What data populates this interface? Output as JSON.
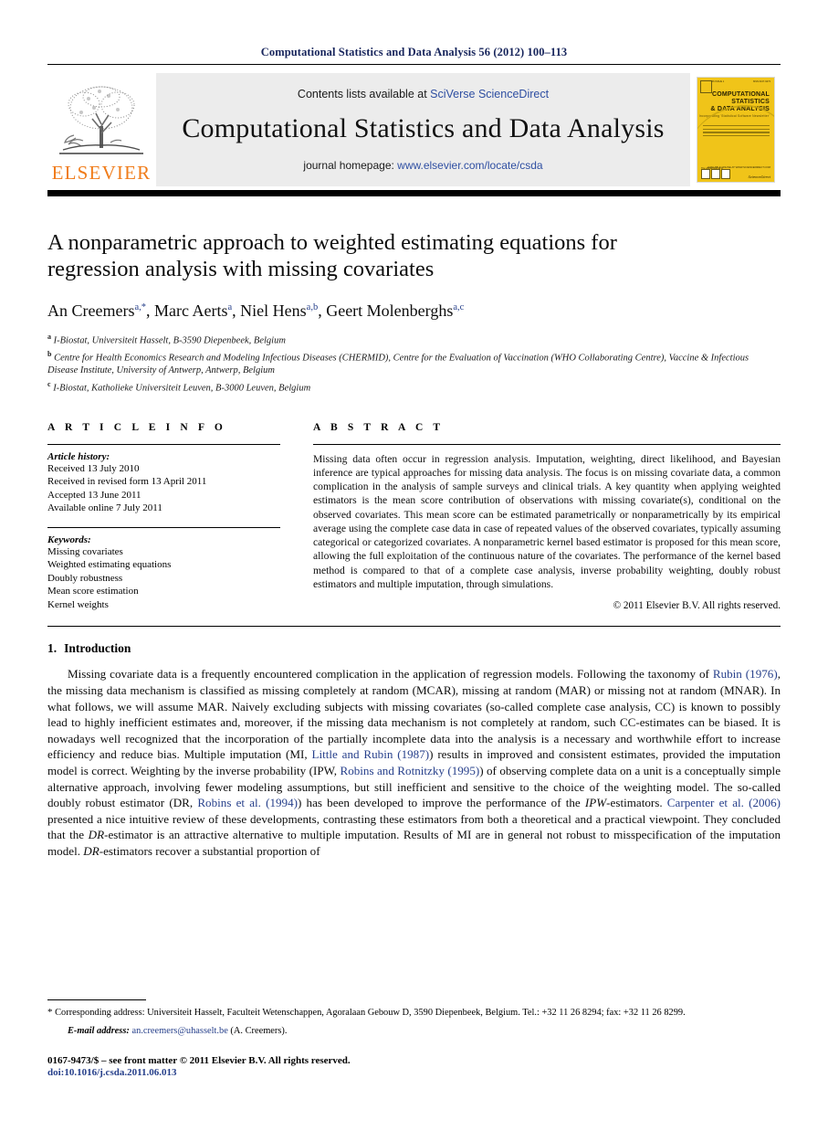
{
  "running_head": "Computational Statistics and Data Analysis 56 (2012) 100–113",
  "banner": {
    "contents_prefix": "Contents lists available at ",
    "contents_link": "SciVerse ScienceDirect",
    "journal_name": "Computational Statistics and Data Analysis",
    "homepage_prefix": "journal homepage: ",
    "homepage_link": "www.elsevier.com/locate/csda",
    "publisher_wordmark": "ELSEVIER",
    "cover": {
      "volume_line": "VOLUME 56 ISSUE 1",
      "date_line": "1 JANUARY 2012",
      "issn_line": "ISSN 0167-9473",
      "title_line_1": "COMPUTATIONAL",
      "title_line_2": "STATISTICS",
      "title_line_3": "& DATA ANALYSIS",
      "subtitle": "Incorporating 'Statistical Software Newsletter'",
      "special_label": "Special Issue",
      "official_line": "The official journal of",
      "available_line": "AVAILABLE ONLINE AT WWW.SCIENCEDIRECT.COM",
      "sciencedirect_label": "ScienceDirect"
    },
    "accent_color": "#f0c419",
    "link_color": "#2f4fa2",
    "elsevier_orange": "#f07c1a"
  },
  "article": {
    "title": "A nonparametric approach to weighted estimating equations for regression analysis with missing covariates",
    "authors": [
      {
        "name": "An Creemers",
        "marks": "a,*"
      },
      {
        "name": "Marc Aerts",
        "marks": "a"
      },
      {
        "name": "Niel Hens",
        "marks": "a,b"
      },
      {
        "name": "Geert Molenberghs",
        "marks": "a,c"
      }
    ],
    "affiliations": [
      {
        "mark": "a",
        "text": "I-Biostat, Universiteit Hasselt, B-3590 Diepenbeek, Belgium"
      },
      {
        "mark": "b",
        "text": "Centre for Health Economics Research and Modeling Infectious Diseases (CHERMID), Centre for the Evaluation of Vaccination (WHO Collaborating Centre), Vaccine & Infectious Disease Institute, University of Antwerp, Antwerp, Belgium"
      },
      {
        "mark": "c",
        "text": "I-Biostat, Katholieke Universiteit Leuven, B-3000 Leuven, Belgium"
      }
    ]
  },
  "info": {
    "heading": "A R T I C L E    I N F O",
    "history_label": "Article history:",
    "history": [
      "Received 13 July 2010",
      "Received in revised form 13 April 2011",
      "Accepted 13 June 2011",
      "Available online 7 July 2011"
    ],
    "keywords_label": "Keywords:",
    "keywords": [
      "Missing covariates",
      "Weighted estimating equations",
      "Doubly robustness",
      "Mean score estimation",
      "Kernel weights"
    ]
  },
  "abstract": {
    "heading": "A B S T R A C T",
    "text": "Missing data often occur in regression analysis. Imputation, weighting, direct likelihood, and Bayesian inference are typical approaches for missing data analysis. The focus is on missing covariate data, a common complication in the analysis of sample surveys and clinical trials. A key quantity when applying weighted estimators is the mean score contribution of observations with missing covariate(s), conditional on the observed covariates. This mean score can be estimated parametrically or nonparametrically by its empirical average using the complete case data in case of repeated values of the observed covariates, typically assuming categorical or categorized covariates. A nonparametric kernel based estimator is proposed for this mean score, allowing the full exploitation of the continuous nature of the covariates. The performance of the kernel based method is compared to that of a complete case analysis, inverse probability weighting, doubly robust estimators and multiple imputation, through simulations.",
    "copyright": "© 2011 Elsevier B.V. All rights reserved."
  },
  "body": {
    "section_number": "1.",
    "section_title": "Introduction",
    "paragraph_1": {
      "p1": "Missing covariate data is a frequently encountered complication in the application of regression models. Following the taxonomy of ",
      "c1": "Rubin (1976)",
      "p2": ", the missing data mechanism is classified as missing completely at random (MCAR), missing at random (MAR) or missing not at random (MNAR). In what follows, we will assume MAR. Naively excluding subjects with missing covariates (so-called complete case analysis, CC) is known to possibly lead to highly inefficient estimates and, moreover, if the missing data mechanism is not completely at random, such CC-estimates can be biased. It is nowadays well recognized that the incorporation of the partially incomplete data into the analysis is a necessary and worthwhile effort to increase efficiency and reduce bias. Multiple imputation (MI, ",
      "c2": "Little and Rubin (1987)",
      "p3": ") results in improved and consistent estimates, provided the imputation model is correct. Weighting by the inverse probability (IPW, ",
      "c3": "Robins and Rotnitzky (1995)",
      "p4": ") of observing complete data on a unit is a conceptually simple alternative approach, involving fewer modeling assumptions, but still inefficient and sensitive to the choice of the weighting model. The so-called doubly robust estimator (DR, ",
      "c4": "Robins et al. (1994)",
      "p5": ") has been developed to improve the performance of the ",
      "em1": "IPW",
      "p6": "-estimators. ",
      "c5": "Carpenter et al. (2006)",
      "p7": " presented a nice intuitive review of these developments, contrasting these estimators from both a theoretical and a practical viewpoint. They concluded that the ",
      "em2": "DR",
      "p8": "-estimator is an attractive alternative to multiple imputation. Results of MI are in general not robust to misspecification of the imputation model. ",
      "em3": "DR",
      "p9": "-estimators recover a substantial proportion of"
    }
  },
  "footer": {
    "corresponding_star": "*",
    "corresponding_text": "Corresponding address: Universiteit Hasselt, Faculteit Wetenschappen, Agoralaan Gebouw D, 3590 Diepenbeek, Belgium. Tel.: +32 11 26 8294; fax: +32 11 26 8299.",
    "email_label": "E-mail address:",
    "email": "an.creemers@uhasselt.be",
    "email_owner": "(A. Creemers).",
    "issn_line": "0167-9473/$ – see front matter © 2011 Elsevier B.V. All rights reserved.",
    "doi_line": "doi:10.1016/j.csda.2011.06.013"
  }
}
